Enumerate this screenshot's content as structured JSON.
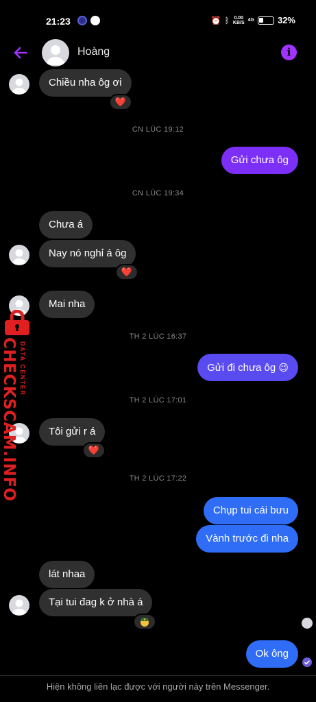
{
  "status_bar": {
    "time": "21:23",
    "network_speed_value": "0.00",
    "network_speed_unit": "KB/S",
    "signal_label": "4G",
    "battery": "32%"
  },
  "header": {
    "contact_name": "Hoàng"
  },
  "messages": [
    {
      "text": "Chiều nha ôg ơi",
      "side": "in",
      "reaction": "❤️"
    },
    {
      "timestamp": "CN LÚC 19:12"
    },
    {
      "text": "Gửi chưa ôg",
      "side": "out",
      "color": "#7b2ff7"
    },
    {
      "timestamp": "CN LÚC 19:34"
    },
    {
      "text": "Chưa á",
      "side": "in"
    },
    {
      "text": "Nay nó nghỉ á ôg",
      "side": "in",
      "reaction": "❤️"
    },
    {
      "text": "Mai nha",
      "side": "in"
    },
    {
      "timestamp": "TH 2 LÚC 16:37"
    },
    {
      "text": "Gửi đi chưa ôg",
      "side": "out",
      "color": "#5a4bf0",
      "emoji": "😉"
    },
    {
      "timestamp": "TH 2 LÚC 17:01"
    },
    {
      "text": "Tôi gửi r á",
      "side": "in",
      "reaction": "❤️"
    },
    {
      "timestamp": "TH 2 LÚC 17:22"
    },
    {
      "text": "Chụp tui cái bưu",
      "side": "out",
      "color": "#2f6df6"
    },
    {
      "text": "Vành trước đi nha",
      "side": "out",
      "color": "#2f6df6"
    },
    {
      "text": "lát nhaa",
      "side": "in"
    },
    {
      "text": "Tại tui đag k ở nhà á",
      "side": "in",
      "reaction": "police-emoji"
    },
    {
      "text": "Ok ông",
      "side": "out",
      "color": "#2f6df6"
    }
  ],
  "footer": {
    "notice": "Hiện không liên lạc được với người này trên Messenger."
  },
  "watermark": {
    "brand": "CHECKSCAM.INFO",
    "subtitle": "DATA CENTER"
  },
  "colors": {
    "accent": "#a033ff",
    "incoming_bubble": "#303030",
    "outgoing_purple": "#7b2ff7",
    "outgoing_blue": "#2f6df6",
    "watermark": "#e02020"
  }
}
